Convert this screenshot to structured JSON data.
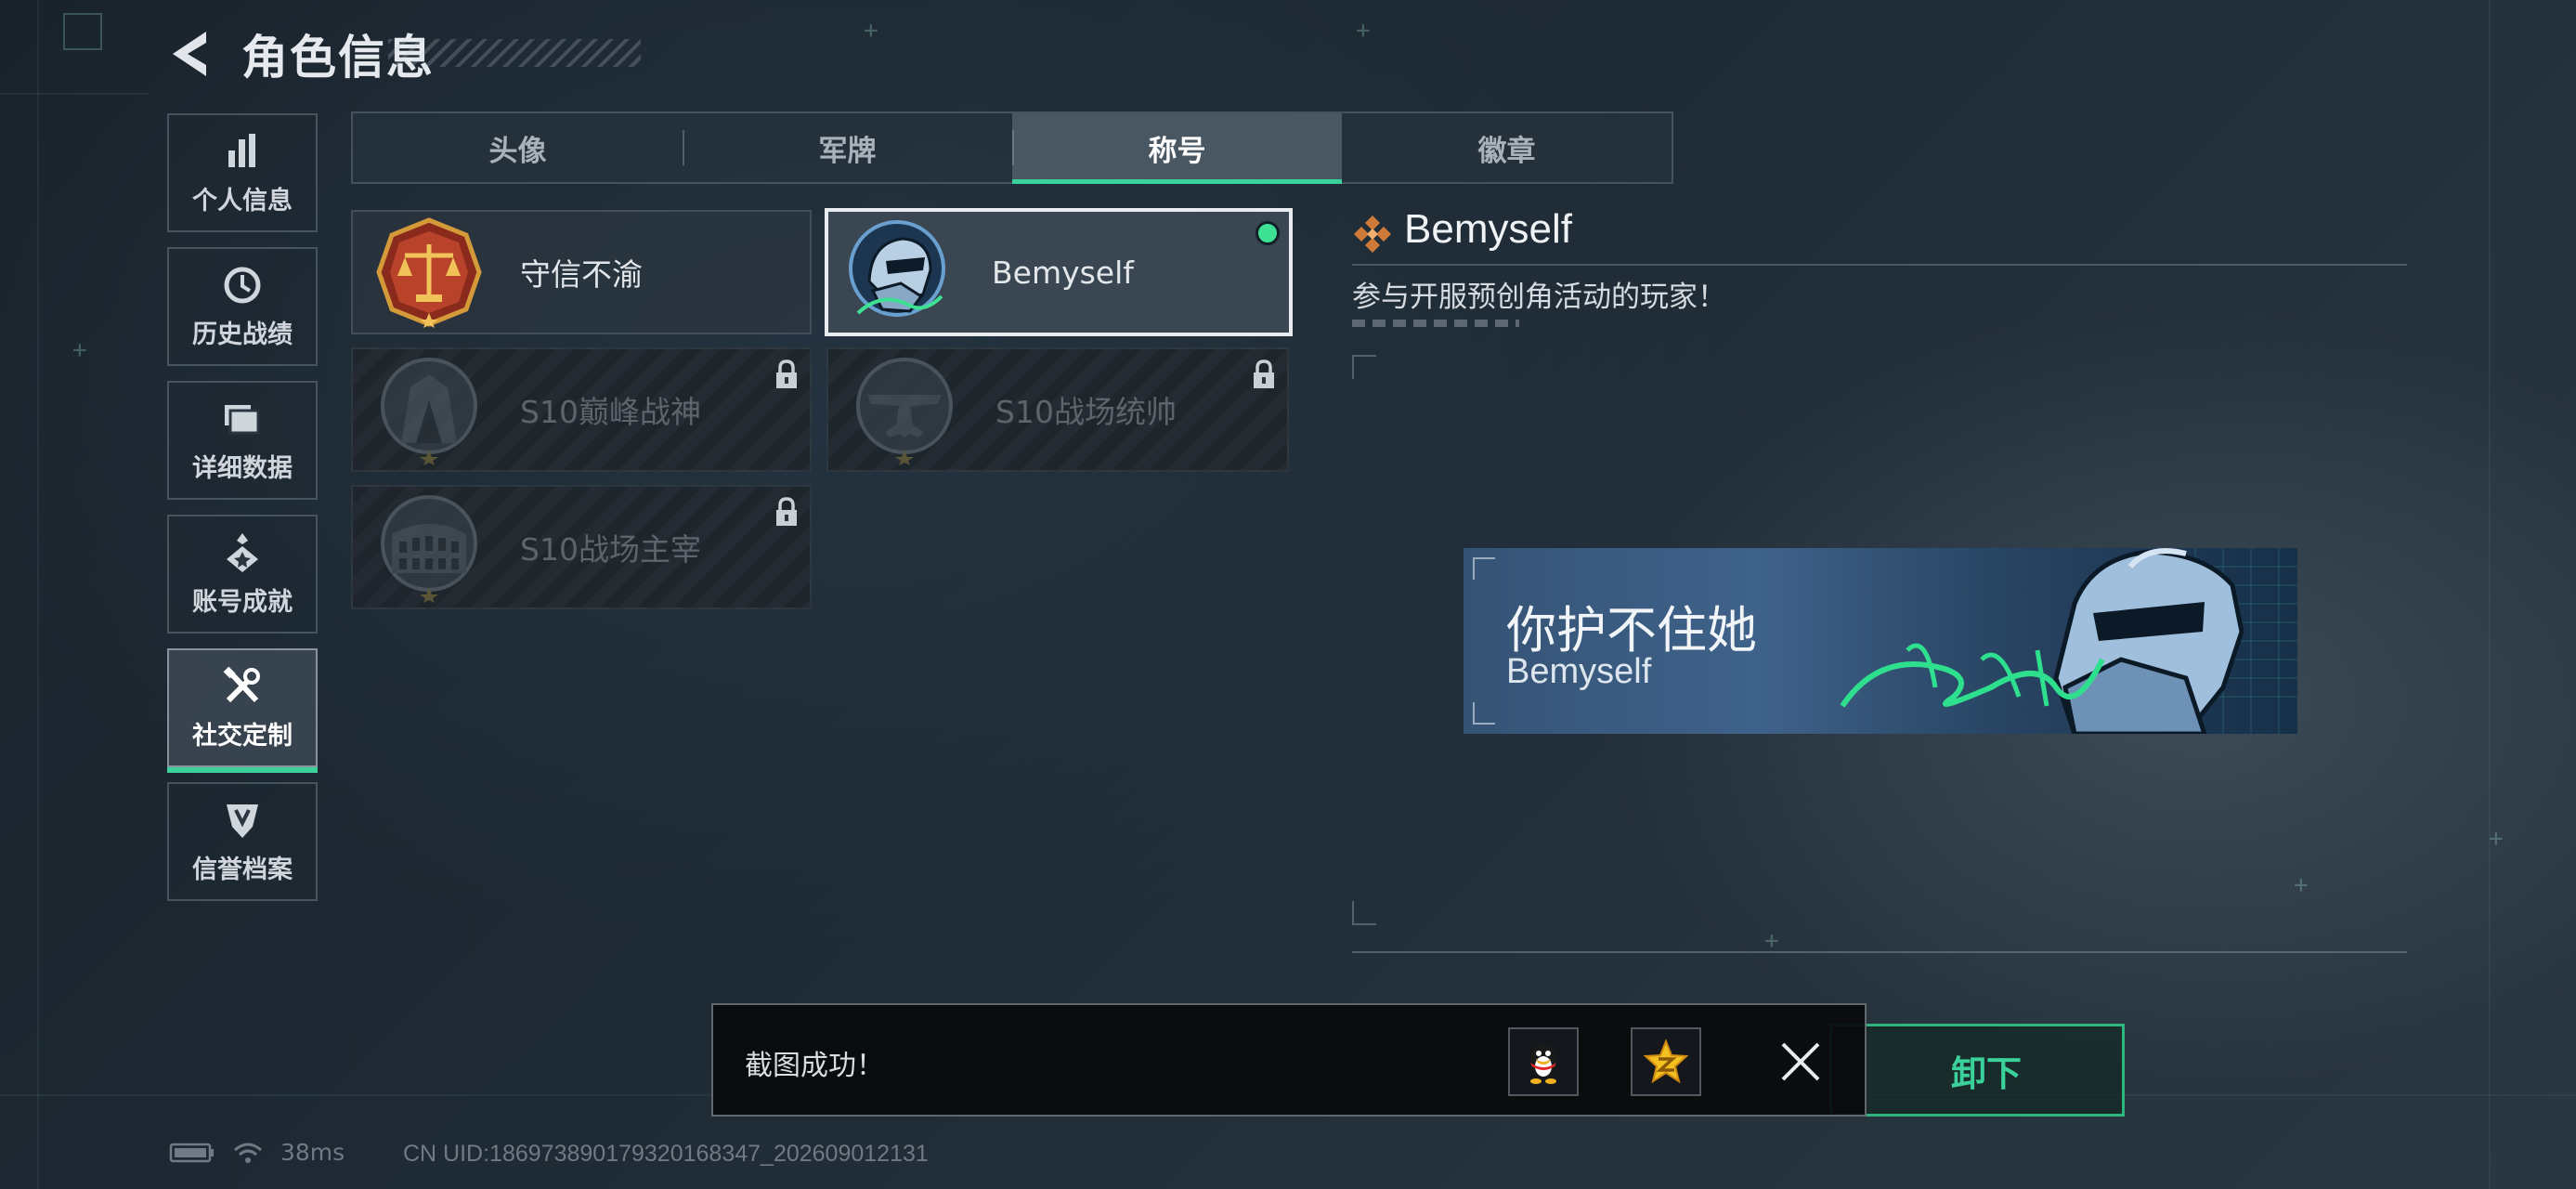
{
  "header": {
    "title": "角色信息"
  },
  "sidebar": {
    "items": [
      {
        "label": "个人信息",
        "icon": "bar-chart-icon",
        "active": false
      },
      {
        "label": "历史战绩",
        "icon": "clock-icon",
        "active": false
      },
      {
        "label": "详细数据",
        "icon": "folder-icon",
        "active": false
      },
      {
        "label": "账号成就",
        "icon": "achievement-icon",
        "active": false
      },
      {
        "label": "社交定制",
        "icon": "tools-icon",
        "active": true
      },
      {
        "label": "信誉档案",
        "icon": "badge-shield-icon",
        "active": false
      }
    ]
  },
  "tabs": [
    {
      "label": "头像",
      "active": false
    },
    {
      "label": "军牌",
      "active": false
    },
    {
      "label": "称号",
      "active": true
    },
    {
      "label": "徽章",
      "active": false
    }
  ],
  "titles": [
    {
      "name": "守信不渝",
      "emblem": "scales-emblem-icon",
      "state": "owned"
    },
    {
      "name": "Bemyself",
      "emblem": "soldier-emblem-icon",
      "state": "equipped"
    },
    {
      "name": "S10巅峰战神",
      "emblem": "building-emblem-icon",
      "state": "locked"
    },
    {
      "name": "S10战场统帅",
      "emblem": "aircraft-emblem-icon",
      "state": "locked"
    },
    {
      "name": "S10战场主宰",
      "emblem": "colosseum-emblem-icon",
      "state": "locked"
    }
  ],
  "detail": {
    "title": "Bemyself",
    "description": "参与开服预创角活动的玩家！",
    "banner": {
      "motto": "你护不住她",
      "name": "Bemyself"
    }
  },
  "toast": {
    "message": "截图成功！",
    "share_targets": [
      "qq-penguin-icon",
      "qzone-star-icon"
    ]
  },
  "actions": {
    "unequip_label": "卸下"
  },
  "status_bar": {
    "ping": "38ms",
    "uid": "CN UID:1869738901793201683​47_202609012131"
  },
  "colors": {
    "accent": "#3ad29a",
    "equipped_dot": "#3ee094"
  }
}
